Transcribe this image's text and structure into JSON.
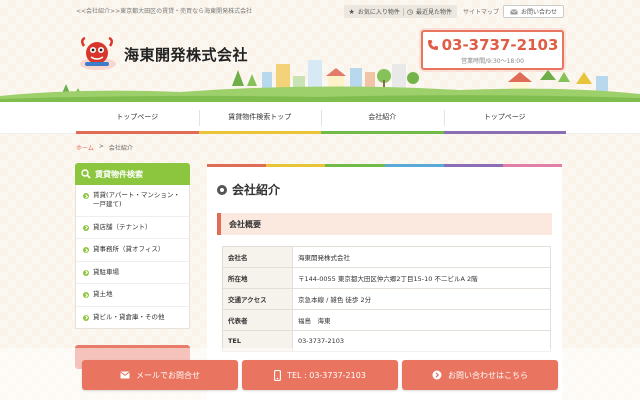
{
  "top": {
    "tagline": "<<会社紹介>>東京都大田区の賃貸・売買なら海東開発株式会社",
    "favorites": "お気に入り物件",
    "recent": "最近見た物件",
    "sitemap": "サイトマップ",
    "contact": "お問い合わせ"
  },
  "header": {
    "company": "海東開発株式会社",
    "tel": "03-3737-2103",
    "hours": "営業時間/9:30～18:00"
  },
  "nav": {
    "items": [
      "トップページ",
      "賃貸物件検索トップ",
      "会社紹介",
      "トップページ"
    ]
  },
  "breadcrumb": {
    "home": "ホーム",
    "sep": ">",
    "current": "会社紹介"
  },
  "sidebar": {
    "title": "賃貸物件検索",
    "items": [
      "賃貸(アパート・マンション・一戸建て)",
      "貸店舗（テナント）",
      "貸事務所（貸オフィス）",
      "貸駐車場",
      "貸土地",
      "貸ビル・貸倉庫・その他"
    ]
  },
  "main": {
    "title": "会社紹介",
    "subheading": "会社概要",
    "rows": [
      {
        "k": "会社名",
        "v": "海東開発株式会社"
      },
      {
        "k": "所在地",
        "v": "〒144-0055 東京都大田区仲六郷2丁目15-10 不二ビルA 2階"
      },
      {
        "k": "交通アクセス",
        "v": "京急本線 / 雑色 徒歩 2分"
      },
      {
        "k": "代表者",
        "v": "福島　海東"
      },
      {
        "k": "TEL",
        "v": "03-3737-2103"
      }
    ]
  },
  "bottom": {
    "mail": "メールでお問合せ",
    "tel": "TEL : 03-3737-2103",
    "inquiry": "お問い合わせはこちら"
  },
  "colors": {
    "accent": "#e9745f",
    "green": "#8cc63f",
    "yellow": "#e8c43b",
    "purple": "#8b6fb5"
  }
}
